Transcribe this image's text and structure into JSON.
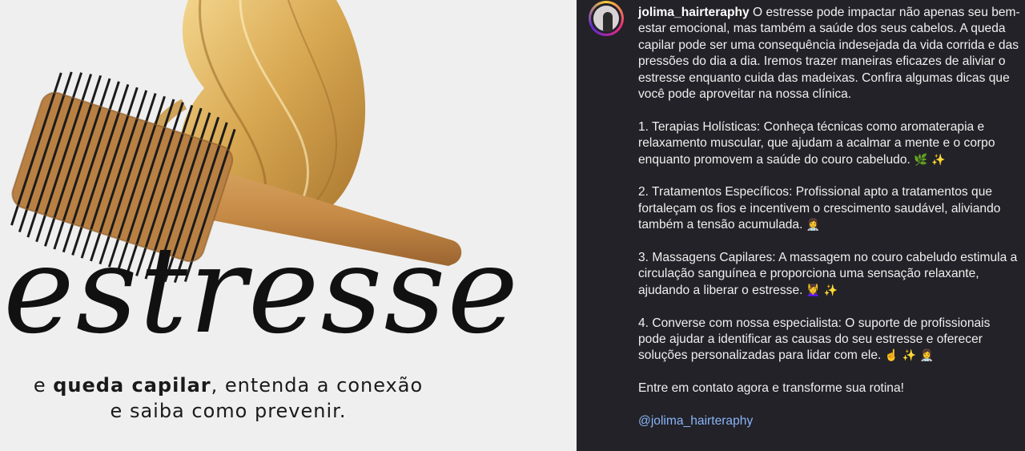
{
  "post": {
    "big_word": "estresse",
    "tagline_prefix": "e ",
    "tagline_bold": "queda capilar",
    "tagline_line1_rest": ", entenda a conexão",
    "tagline_line2": "e saiba como prevenir."
  },
  "caption": {
    "username": "jolima_hairteraphy",
    "intro": "O estresse pode impactar não apenas seu bem-estar emocional, mas também a saúde dos seus cabelos. A queda capilar pode ser uma consequência indesejada da vida corrida e das pressões do dia a dia. Iremos trazer maneiras eficazes de aliviar o estresse enquanto cuida das madeixas. Confira algumas dicas que você pode aproveitar na nossa clínica.",
    "tips": [
      {
        "text": "1. Terapias Holísticas: Conheça técnicas como aromaterapia e relaxamento muscular, que ajudam a acalmar a mente e o corpo enquanto promovem a saúde do couro cabeludo.",
        "emojis": "🌿 ✨"
      },
      {
        "text": "2. Tratamentos Específicos: Profissional apto a tratamentos que fortaleçam os fios e incentivem o crescimento saudável, aliviando também a tensão acumulada.",
        "emojis": "👩‍⚕️"
      },
      {
        "text": "3. Massagens Capilares: A massagem no couro cabeludo estimula a circulação sanguínea e proporciona uma sensação relaxante, ajudando a liberar o estresse.",
        "emojis": "💆‍♀️ ✨"
      },
      {
        "text": "4. Converse com nossa especialista: O suporte de profissionais pode ajudar a identificar as causas do seu estresse e oferecer soluções personalizadas para lidar com ele.",
        "emojis": "☝️ ✨ 👩‍⚕️"
      }
    ],
    "cta": "Entre em contato agora e transforme sua rotina!",
    "mention": "@jolima_hairteraphy"
  },
  "colors": {
    "panel_bg": "#222228",
    "image_bg": "#efefef",
    "mention": "#8ab4f8"
  }
}
